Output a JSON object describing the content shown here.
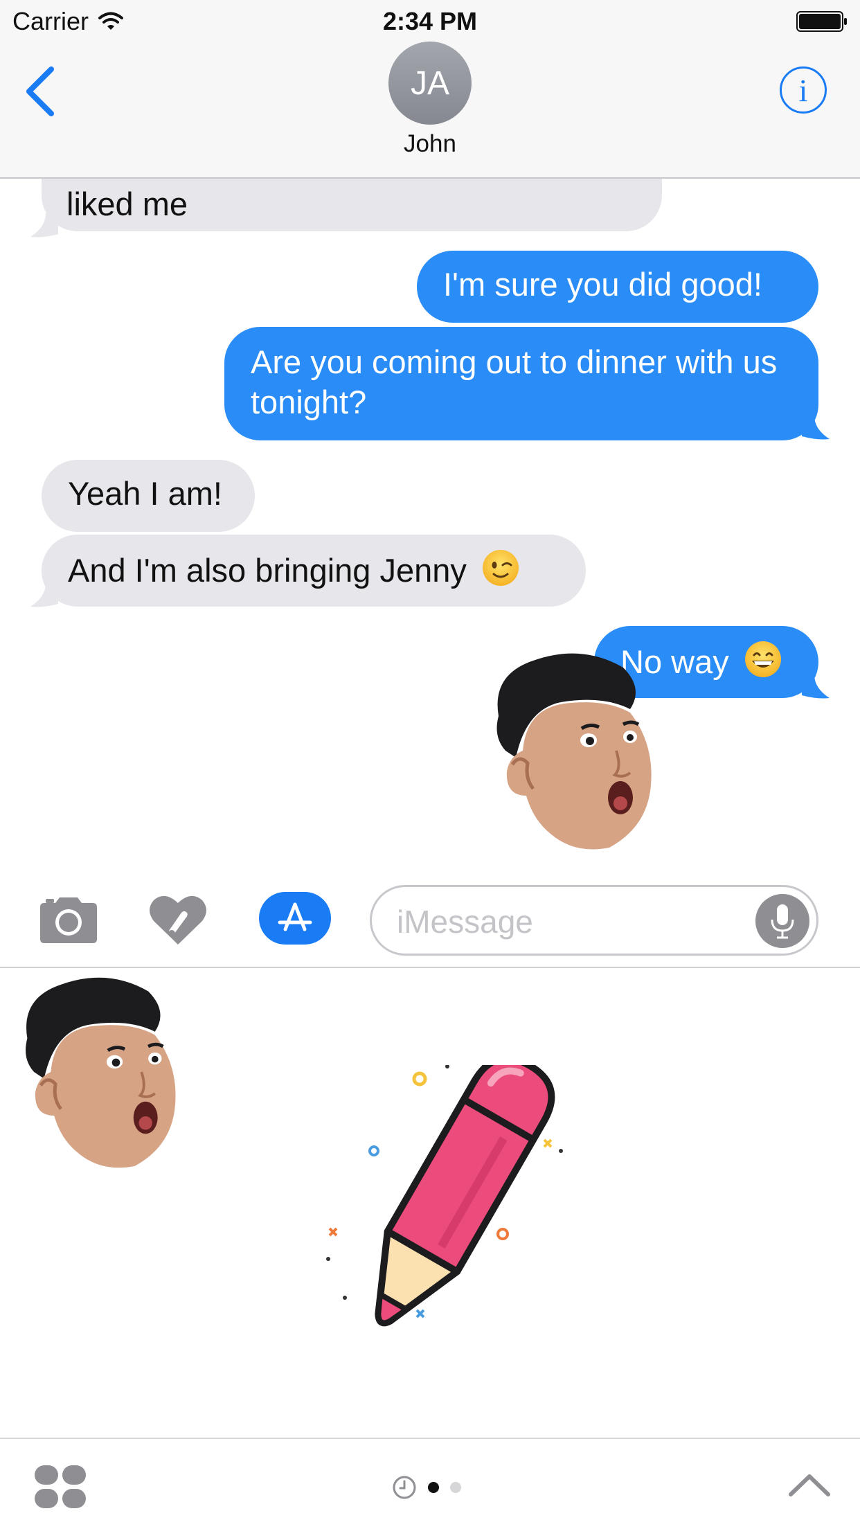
{
  "status_bar": {
    "carrier": "Carrier",
    "time": "2:34 PM"
  },
  "header": {
    "avatar_initials": "JA",
    "contact_name": "John",
    "info_label": "i"
  },
  "messages": [
    {
      "direction": "incoming",
      "text": "liked me"
    },
    {
      "direction": "outgoing",
      "text": "I'm sure you did good!"
    },
    {
      "direction": "outgoing",
      "text": "Are you coming out to dinner with us tonight?"
    },
    {
      "direction": "incoming",
      "text": "Yeah I am!"
    },
    {
      "direction": "incoming",
      "text": "And I'm also bringing Jenny",
      "emoji": "winking-face"
    },
    {
      "direction": "outgoing",
      "text": "No way",
      "emoji": "grinning-face"
    }
  ],
  "input_bar": {
    "placeholder": "iMessage",
    "value": ""
  },
  "drawer": {
    "stickers": [
      "surprised-face-sticker",
      "pencil-sticker"
    ]
  },
  "bottom_bar": {
    "pages": 2,
    "active_page": 1
  },
  "colors": {
    "accent": "#1a7cf4",
    "outgoing_bubble": "#2a8cf6",
    "incoming_bubble": "#e6e6eb"
  }
}
